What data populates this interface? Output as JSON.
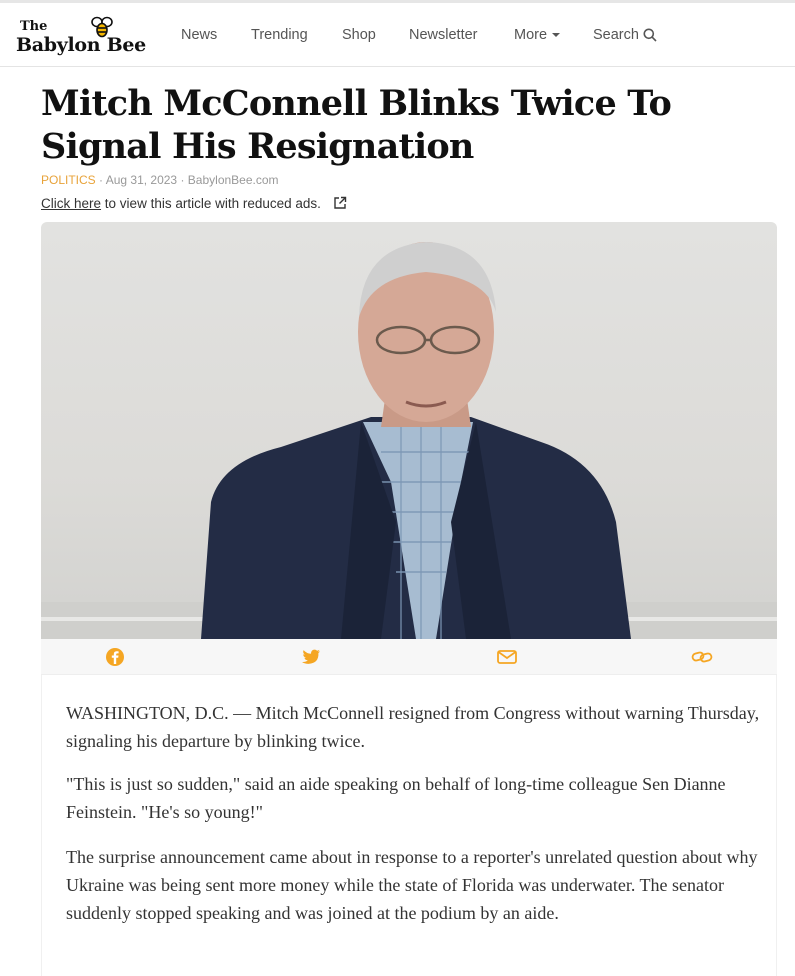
{
  "site": {
    "logo_the": "The",
    "logo_name": "Babylon Bee",
    "nav": {
      "news": "News",
      "trending": "Trending",
      "shop": "Shop",
      "newsletter": "Newsletter",
      "more": "More",
      "search": "Search"
    }
  },
  "article": {
    "title_line1": "Mitch McConnell Blinks Twice To",
    "title_line2": "Signal His Resignation",
    "category": "POLITICS",
    "date": "Aug 31, 2023",
    "source": "BabylonBee.com",
    "reduced_ads_link": "Click here",
    "reduced_ads_text": "to view this article with reduced ads.",
    "paragraphs": [
      "WASHINGTON, D.C. — Mitch McConnell resigned from Congress without warning Thursday, signaling his departure by blinking twice.",
      "\"This is just so sudden,\" said an aide speaking on behalf of long-time colleague Sen Dianne Feinstein. \"He's so young!\"",
      "The surprise announcement came about in response to a reporter's unrelated question about why Ukraine was being sent more money while the state of Florida was underwater. The senator suddenly stopped speaking and was joined at the podium by an aide."
    ]
  },
  "share": [
    "facebook-icon",
    "twitter-icon",
    "email-icon",
    "link-icon"
  ],
  "colors": {
    "accent": "#f5a623",
    "category": "#e8a33a",
    "title": "#111111",
    "body_text": "#333333"
  },
  "icons": {
    "logo": "bee-icon",
    "more": "caret-down-icon",
    "search": "search-icon",
    "external": "external-link-icon"
  }
}
